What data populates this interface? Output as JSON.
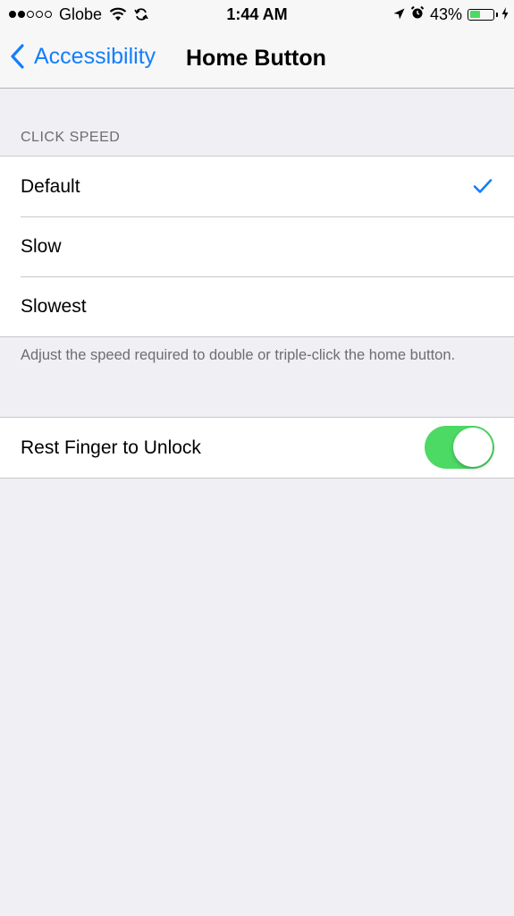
{
  "status_bar": {
    "carrier": "Globe",
    "time": "1:44 AM",
    "battery_percent": "43%",
    "battery_level": 0.43,
    "signal_strength": 2,
    "signal_max": 5,
    "icons": [
      "wifi-icon",
      "sync-icon",
      "location-icon",
      "alarm-icon",
      "battery-icon",
      "charging-icon"
    ]
  },
  "nav": {
    "back_label": "Accessibility",
    "title": "Home Button"
  },
  "click_speed": {
    "header": "CLICK SPEED",
    "options": [
      {
        "label": "Default",
        "selected": true
      },
      {
        "label": "Slow",
        "selected": false
      },
      {
        "label": "Slowest",
        "selected": false
      }
    ],
    "footer": "Adjust the speed required to double or triple-click the home button."
  },
  "rest_finger": {
    "label": "Rest Finger to Unlock",
    "enabled": true
  },
  "colors": {
    "accent": "#147efb",
    "toggle_on": "#4cd964",
    "background": "#efeff4"
  }
}
